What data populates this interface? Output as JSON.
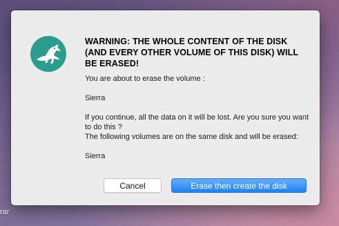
{
  "desktop": {
    "label_fragment": "rar"
  },
  "dialog": {
    "icon": "app-logo-icon",
    "title": "WARNING: THE WHOLE CONTENT OF THE DISK (AND EVERY OTHER VOLUME OF THIS DISK) WILL BE ERASED!",
    "intro": "You are about to erase the volume :",
    "volume_name": "Sierra",
    "confirm_line_1": "If you continue, all the data on it will be lost. Are you sure you want to do this ?",
    "confirm_line_2": "The following volumes are on the same disk and will be erased:",
    "affected_volume": "Sierra",
    "buttons": {
      "cancel_label": "Cancel",
      "confirm_label": "Erase then create the disk"
    }
  },
  "colors": {
    "accent": "#1f83f2",
    "icon_teal": "#2a9d8f",
    "dialog_bg": "#ececec"
  }
}
